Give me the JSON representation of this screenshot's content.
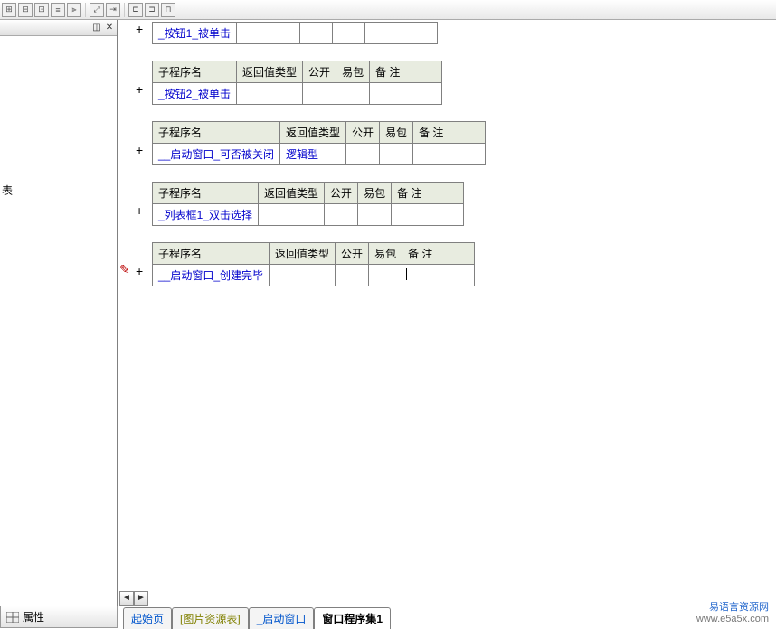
{
  "toolbar": {
    "buttons": [
      "a",
      "b",
      "c",
      "d",
      "e",
      "f",
      "g",
      "h",
      "i",
      "j",
      "k"
    ]
  },
  "leftPanel": {
    "label": "表",
    "propBtn": "属性"
  },
  "headers": {
    "subName": "子程序名",
    "retType": "返回值类型",
    "public": "公开",
    "pkg": "易包",
    "remark": "备 注"
  },
  "subs": [
    {
      "name": "_按钮1_被单击",
      "retType": "",
      "showHeader": false
    },
    {
      "name": "_按钮2_被单击",
      "retType": "",
      "showHeader": true
    },
    {
      "name": "__启动窗口_可否被关闭",
      "retType": "逻辑型",
      "showHeader": true
    },
    {
      "name": "_列表框1_双击选择",
      "retType": "",
      "showHeader": true
    },
    {
      "name": "__启动窗口_创建完毕",
      "retType": "",
      "showHeader": true,
      "editing": true,
      "redMark": true
    }
  ],
  "tabs": [
    {
      "label": "起始页",
      "style": "blue"
    },
    {
      "label": "[图片资源表]",
      "style": "olive"
    },
    {
      "label": "_启动窗口",
      "style": "blue"
    },
    {
      "label": "窗口程序集1",
      "style": "active"
    }
  ],
  "watermark": {
    "title": "易语言资源网",
    "url": "www.e5a5x.com"
  }
}
